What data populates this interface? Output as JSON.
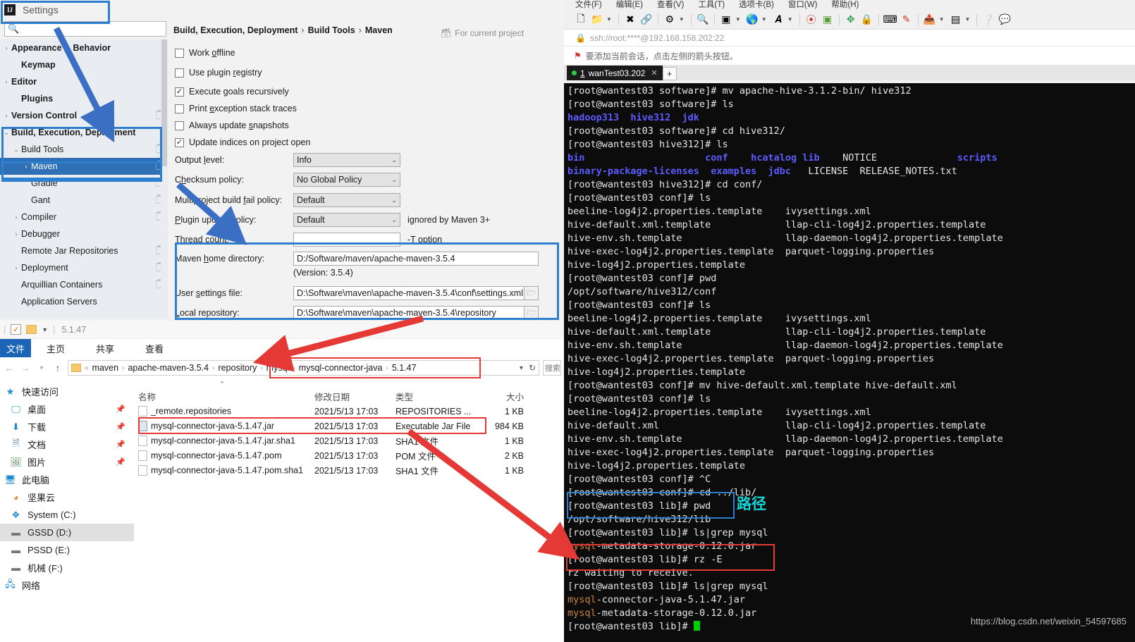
{
  "settings": {
    "title": "Settings",
    "logo_text": "IJ",
    "search_placeholder": "",
    "search_icon": "search-icon",
    "tree": [
      {
        "label": "Appearance & Behavior",
        "arrow": "›",
        "bold": true,
        "copy": false,
        "selected": false,
        "indent": 0
      },
      {
        "label": "Keymap",
        "arrow": "",
        "bold": true,
        "copy": false,
        "selected": false,
        "indent": 1
      },
      {
        "label": "Editor",
        "arrow": "›",
        "bold": true,
        "copy": false,
        "selected": false,
        "indent": 0
      },
      {
        "label": "Plugins",
        "arrow": "",
        "bold": true,
        "copy": false,
        "selected": false,
        "indent": 1
      },
      {
        "label": "Version Control",
        "arrow": "›",
        "bold": true,
        "copy": true,
        "selected": false,
        "indent": 0
      },
      {
        "label": "Build, Execution, Deployment",
        "arrow": "⌄",
        "bold": true,
        "copy": false,
        "selected": false,
        "indent": 0
      },
      {
        "label": "Build Tools",
        "arrow": "⌄",
        "bold": false,
        "copy": true,
        "selected": false,
        "indent": 1
      },
      {
        "label": "Maven",
        "arrow": "›",
        "bold": false,
        "copy": true,
        "selected": true,
        "indent": 2
      },
      {
        "label": "Gradle",
        "arrow": "",
        "bold": false,
        "copy": true,
        "selected": false,
        "indent": 2
      },
      {
        "label": "Gant",
        "arrow": "",
        "bold": false,
        "copy": true,
        "selected": false,
        "indent": 2
      },
      {
        "label": "Compiler",
        "arrow": "›",
        "bold": false,
        "copy": true,
        "selected": false,
        "indent": 1
      },
      {
        "label": "Debugger",
        "arrow": "›",
        "bold": false,
        "copy": false,
        "selected": false,
        "indent": 1
      },
      {
        "label": "Remote Jar Repositories",
        "arrow": "",
        "bold": false,
        "copy": true,
        "selected": false,
        "indent": 1
      },
      {
        "label": "Deployment",
        "arrow": "›",
        "bold": false,
        "copy": true,
        "selected": false,
        "indent": 1
      },
      {
        "label": "Arquillian Containers",
        "arrow": "",
        "bold": false,
        "copy": true,
        "selected": false,
        "indent": 1
      },
      {
        "label": "Application Servers",
        "arrow": "",
        "bold": false,
        "copy": false,
        "selected": false,
        "indent": 1
      }
    ],
    "breadcrumb": [
      "Build, Execution, Deployment",
      "Build Tools",
      "Maven"
    ],
    "breadcrumb_sep": "›",
    "for_current_project": "For current project",
    "checkboxes": [
      {
        "label_pre": "Work ",
        "mnemonic": "o",
        "label_post": "ffline",
        "checked": false
      },
      {
        "label_pre": "Use plugin ",
        "mnemonic": "r",
        "label_post": "egistry",
        "checked": false
      },
      {
        "label_pre": "Execute ",
        "mnemonic": "g",
        "label_post": "oals recursively",
        "checked": true
      },
      {
        "label_pre": "Print ",
        "mnemonic": "e",
        "label_post": "xception stack traces",
        "checked": false
      },
      {
        "label_pre": "Always update ",
        "mnemonic": "s",
        "label_post": "napshots",
        "checked": false
      },
      {
        "label_pre": "Update indices on project open",
        "mnemonic": "",
        "label_post": "",
        "checked": true
      }
    ],
    "check_glyph": "✓",
    "fields": [
      {
        "label_pre": "Output ",
        "mnemonic": "l",
        "label_post": "evel:",
        "value": "Info",
        "kind": "combo",
        "hint": ""
      },
      {
        "label_pre": "C",
        "mnemonic": "h",
        "label_post": "ecksum policy:",
        "value": "No Global Policy",
        "kind": "combo",
        "hint": ""
      },
      {
        "label_pre": "Multiproject build ",
        "mnemonic": "f",
        "label_post": "ail policy:",
        "value": "Default",
        "kind": "combo",
        "hint": ""
      },
      {
        "label_pre": "",
        "mnemonic": "P",
        "label_post": "lugin update policy:",
        "value": "Default",
        "kind": "combo",
        "hint": "ignored by Maven 3+"
      },
      {
        "label_pre": "Thread count:",
        "mnemonic": "",
        "label_post": "",
        "value": "",
        "kind": "text",
        "hint": "-T option"
      }
    ],
    "combo_arrow": "⌄",
    "paths": {
      "maven_home_label_pre": "Maven ",
      "maven_home_mnemonic": "h",
      "maven_home_label_post": "ome directory:",
      "maven_home_value": "D:/Software/maven/apache-maven-3.5.4",
      "version_note": "(Version: 3.5.4)",
      "user_settings_label_pre": "User ",
      "user_settings_mnemonic": "s",
      "user_settings_label_post": "ettings file:",
      "user_settings_value": "D:\\Software\\maven\\apache-maven-3.5.4\\conf\\settings.xml",
      "local_repo_label_pre": "",
      "local_repo_mnemonic": "L",
      "local_repo_label_post": "ocal repository:",
      "local_repo_value": "D:\\Software\\maven\\apache-maven-3.5.4\\repository",
      "browse_icon": "folder-browse-icon"
    }
  },
  "explorer": {
    "quickbar": {
      "title": "5.1.47",
      "check_icon": "save-check-icon",
      "folder_icon": "folder-icon",
      "dropdown_icon": "chevron-down-icon"
    },
    "ribbon": {
      "file_tab": "文件",
      "tabs": [
        "主页",
        "共享",
        "查看"
      ]
    },
    "address": {
      "back_icon": "back-arrow-icon",
      "forward_icon": "forward-arrow-icon",
      "recent_icon": "chevron-down-icon",
      "up_icon": "up-arrow-icon",
      "overflow": "«",
      "crumbs": [
        "maven",
        "apache-maven-3.5.4",
        "repository",
        "mysql",
        "mysql-connector-java",
        "5.1.47"
      ],
      "crumb_sep": "›",
      "dropdown_icon": "chevron-down-icon",
      "refresh_icon": "refresh-icon",
      "search_label": "搜索"
    },
    "nav_items": [
      {
        "label": "快速访问",
        "icon": "star-icon",
        "pin": false,
        "indent": false,
        "selected": false
      },
      {
        "label": "桌面",
        "icon": "desktop-icon",
        "pin": true,
        "indent": true,
        "selected": false
      },
      {
        "label": "下载",
        "icon": "download-icon",
        "pin": true,
        "indent": true,
        "selected": false
      },
      {
        "label": "文档",
        "icon": "documents-icon",
        "pin": true,
        "indent": true,
        "selected": false
      },
      {
        "label": "图片",
        "icon": "pictures-icon",
        "pin": true,
        "indent": true,
        "selected": false
      },
      {
        "label": "此电脑",
        "icon": "this-pc-icon",
        "pin": false,
        "indent": false,
        "selected": false
      },
      {
        "label": "坚果云",
        "icon": "nutstore-icon",
        "pin": false,
        "indent": true,
        "selected": false
      },
      {
        "label": "System (C:)",
        "icon": "windows-drive-icon",
        "pin": false,
        "indent": true,
        "selected": false
      },
      {
        "label": "GSSD (D:)",
        "icon": "drive-icon",
        "pin": false,
        "indent": true,
        "selected": true
      },
      {
        "label": "PSSD (E:)",
        "icon": "drive-icon",
        "pin": false,
        "indent": true,
        "selected": false
      },
      {
        "label": "机械 (F:)",
        "icon": "drive-icon",
        "pin": false,
        "indent": true,
        "selected": false
      },
      {
        "label": "网络",
        "icon": "network-icon",
        "pin": false,
        "indent": false,
        "selected": false
      }
    ],
    "columns": [
      "名称",
      "修改日期",
      "类型",
      "大小"
    ],
    "sort_marker": "⌃",
    "files": [
      {
        "name": "_remote.repositories",
        "date": "2021/5/13 17:03",
        "type": "REPOSITORIES ...",
        "size": "1 KB",
        "icon": "file-icon",
        "highlighted": false
      },
      {
        "name": "mysql-connector-java-5.1.47.jar",
        "date": "2021/5/13 17:03",
        "type": "Executable Jar File",
        "size": "984 KB",
        "icon": "jar-file-icon",
        "highlighted": true
      },
      {
        "name": "mysql-connector-java-5.1.47.jar.sha1",
        "date": "2021/5/13 17:03",
        "type": "SHA1 文件",
        "size": "1 KB",
        "icon": "file-icon",
        "highlighted": false
      },
      {
        "name": "mysql-connector-java-5.1.47.pom",
        "date": "2021/5/13 17:03",
        "type": "POM 文件",
        "size": "2 KB",
        "icon": "file-icon",
        "highlighted": false
      },
      {
        "name": "mysql-connector-java-5.1.47.pom.sha1",
        "date": "2021/5/13 17:03",
        "type": "SHA1 文件",
        "size": "1 KB",
        "icon": "file-icon",
        "highlighted": false
      }
    ]
  },
  "terminal": {
    "menus": [
      "文件(F)",
      "编辑(E)",
      "查看(V)",
      "工具(T)",
      "选项卡(B)",
      "窗口(W)",
      "帮助(H)"
    ],
    "toolbar_icons": [
      "new-session-icon",
      "open-folder-icon",
      "disconnect-icon",
      "link-icon",
      "properties-icon",
      "find-icon",
      "transfer-icon",
      "globe-icon",
      "font-icon",
      "log-icon",
      "record-icon",
      "fullscreen-icon",
      "lock-icon",
      "keyboard-icon",
      "highlight-icon",
      "export-icon",
      "layout-icon",
      "help-icon",
      "comment-icon"
    ],
    "url": "ssh://root:****@192.168.158.202:22",
    "lock_icon": "lock-icon",
    "notice": "要添加当前会话，点击左侧的箭头按钮。",
    "notice_icon": "flag-icon",
    "tab": {
      "index": "1",
      "title": "wanTest03.202",
      "close_icon": "close-icon"
    },
    "new_tab_icon": "plus-icon",
    "annotation_path": "路径",
    "watermark": "https://blog.csdn.net/weixin_54597685",
    "lines": [
      [
        {
          "t": "[root@wantest03 software]# mv apache-hive-3.1.2-bin/ hive312",
          "c": "w"
        }
      ],
      [
        {
          "t": "[root@wantest03 software]# ls",
          "c": "w"
        }
      ],
      [
        {
          "t": "hadoop313  hive312  jdk",
          "c": "b"
        }
      ],
      [
        {
          "t": "[root@wantest03 software]# cd hive312/",
          "c": "w"
        }
      ],
      [
        {
          "t": "[root@wantest03 hive312]# ls",
          "c": "w"
        }
      ],
      [
        {
          "t": "bin                     ",
          "c": "b"
        },
        {
          "t": "conf",
          "c": "b"
        },
        {
          "t": "    ",
          "c": "w"
        },
        {
          "t": "hcatalog",
          "c": "b"
        },
        {
          "t": " ",
          "c": "w"
        },
        {
          "t": "lib",
          "c": "b"
        },
        {
          "t": "    NOTICE              ",
          "c": "w"
        },
        {
          "t": "scripts",
          "c": "b"
        }
      ],
      [
        {
          "t": "binary-package-licenses",
          "c": "b"
        },
        {
          "t": "  ",
          "c": "w"
        },
        {
          "t": "examples",
          "c": "b"
        },
        {
          "t": "  ",
          "c": "w"
        },
        {
          "t": "jdbc",
          "c": "b"
        },
        {
          "t": "   LICENSE  RELEASE_NOTES.txt",
          "c": "w"
        }
      ],
      [
        {
          "t": "[root@wantest03 hive312]# cd conf/",
          "c": "w"
        }
      ],
      [
        {
          "t": "[root@wantest03 conf]# ls",
          "c": "w"
        }
      ],
      [
        {
          "t": "beeline-log4j2.properties.template    ivysettings.xml",
          "c": "w"
        }
      ],
      [
        {
          "t": "hive-default.xml.template             llap-cli-log4j2.properties.template",
          "c": "w"
        }
      ],
      [
        {
          "t": "hive-env.sh.template                  llap-daemon-log4j2.properties.template",
          "c": "w"
        }
      ],
      [
        {
          "t": "hive-exec-log4j2.properties.template  parquet-logging.properties",
          "c": "w"
        }
      ],
      [
        {
          "t": "hive-log4j2.properties.template",
          "c": "w"
        }
      ],
      [
        {
          "t": "[root@wantest03 conf]# pwd",
          "c": "w"
        }
      ],
      [
        {
          "t": "/opt/software/hive312/conf",
          "c": "w"
        }
      ],
      [
        {
          "t": "[root@wantest03 conf]# ls",
          "c": "w"
        }
      ],
      [
        {
          "t": "beeline-log4j2.properties.template    ivysettings.xml",
          "c": "w"
        }
      ],
      [
        {
          "t": "hive-default.xml.template             llap-cli-log4j2.properties.template",
          "c": "w"
        }
      ],
      [
        {
          "t": "hive-env.sh.template                  llap-daemon-log4j2.properties.template",
          "c": "w"
        }
      ],
      [
        {
          "t": "hive-exec-log4j2.properties.template  parquet-logging.properties",
          "c": "w"
        }
      ],
      [
        {
          "t": "hive-log4j2.properties.template",
          "c": "w"
        }
      ],
      [
        {
          "t": "[root@wantest03 conf]# mv hive-default.xml.template hive-default.xml",
          "c": "w"
        }
      ],
      [
        {
          "t": "[root@wantest03 conf]# ls",
          "c": "w"
        }
      ],
      [
        {
          "t": "beeline-log4j2.properties.template    ivysettings.xml",
          "c": "w"
        }
      ],
      [
        {
          "t": "hive-default.xml                      llap-cli-log4j2.properties.template",
          "c": "w"
        }
      ],
      [
        {
          "t": "hive-env.sh.template                  llap-daemon-log4j2.properties.template",
          "c": "w"
        }
      ],
      [
        {
          "t": "hive-exec-log4j2.properties.template  parquet-logging.properties",
          "c": "w"
        }
      ],
      [
        {
          "t": "hive-log4j2.properties.template",
          "c": "w"
        }
      ],
      [
        {
          "t": "[root@wantest03 conf]# ^C",
          "c": "w"
        }
      ],
      [
        {
          "t": "[root@wantest03 conf]# cd ../lib/",
          "c": "w"
        }
      ],
      [
        {
          "t": "[root@wantest03 lib]# pwd",
          "c": "w"
        }
      ],
      [
        {
          "t": "/opt/software/hive312/lib",
          "c": "w"
        }
      ],
      [
        {
          "t": "[root@wantest03 lib]# ls|grep mysql",
          "c": "w"
        }
      ],
      [
        {
          "t": "mysql",
          "c": "o"
        },
        {
          "t": "-metadata-storage-0.12.0.jar",
          "c": "w"
        }
      ],
      [
        {
          "t": "[root@wantest03 lib]# rz -E",
          "c": "w"
        }
      ],
      [
        {
          "t": "rz waiting to receive.",
          "c": "w"
        }
      ],
      [
        {
          "t": "[root@wantest03 lib]# ls|grep mysql",
          "c": "w"
        }
      ],
      [
        {
          "t": "mysql",
          "c": "o"
        },
        {
          "t": "-connector-java-5.1.47.jar",
          "c": "w"
        }
      ],
      [
        {
          "t": "mysql",
          "c": "o"
        },
        {
          "t": "-metadata-storage-0.12.0.jar",
          "c": "w"
        }
      ],
      [
        {
          "t": "[root@wantest03 lib]# ",
          "c": "w"
        },
        {
          "t": "CURSOR",
          "c": "cursor"
        }
      ]
    ]
  },
  "annotations": {
    "blue_boxes": [
      "settings-title-box",
      "build-exec-deploy-box",
      "maven-path-fields-box",
      "terminal-pwd-box"
    ],
    "red_boxes": [
      "explorer-crumb-box",
      "jar-file-row-box",
      "rz-command-box"
    ],
    "arrow_color_blue": "#3a6fc4",
    "arrow_color_red": "#e53935"
  }
}
